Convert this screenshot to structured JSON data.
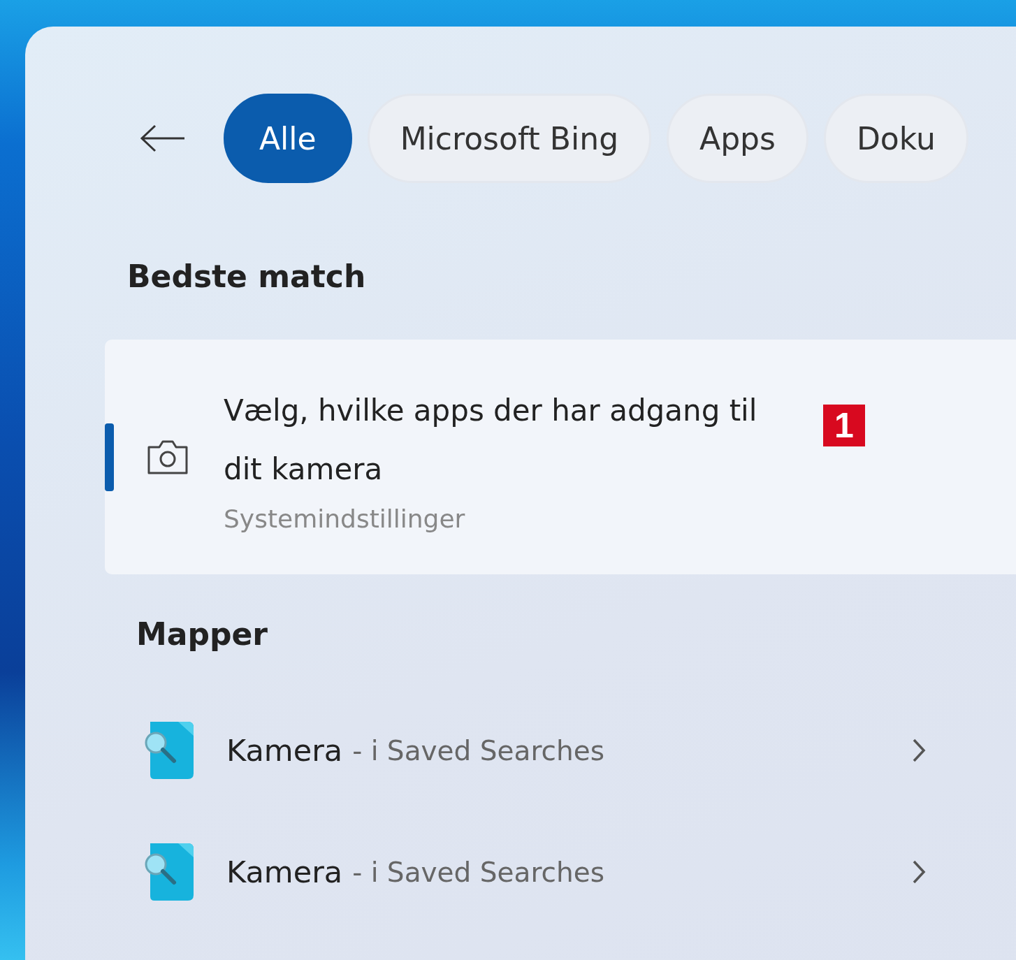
{
  "tabs": [
    {
      "label": "Alle",
      "selected": true
    },
    {
      "label": "Microsoft Bing",
      "selected": false
    },
    {
      "label": "Apps",
      "selected": false
    },
    {
      "label": "Doku",
      "selected": false
    }
  ],
  "best_match": {
    "heading": "Bedste match",
    "title": "Vælg, hvilke apps der har adgang til dit kamera",
    "subtitle": "Systemindstillinger",
    "selected": true,
    "callout": "1"
  },
  "folders": {
    "heading": "Mapper",
    "items": [
      {
        "name": "Kamera",
        "detail": "- i Saved Searches"
      },
      {
        "name": "Kamera",
        "detail": "- i Saved Searches"
      }
    ]
  }
}
